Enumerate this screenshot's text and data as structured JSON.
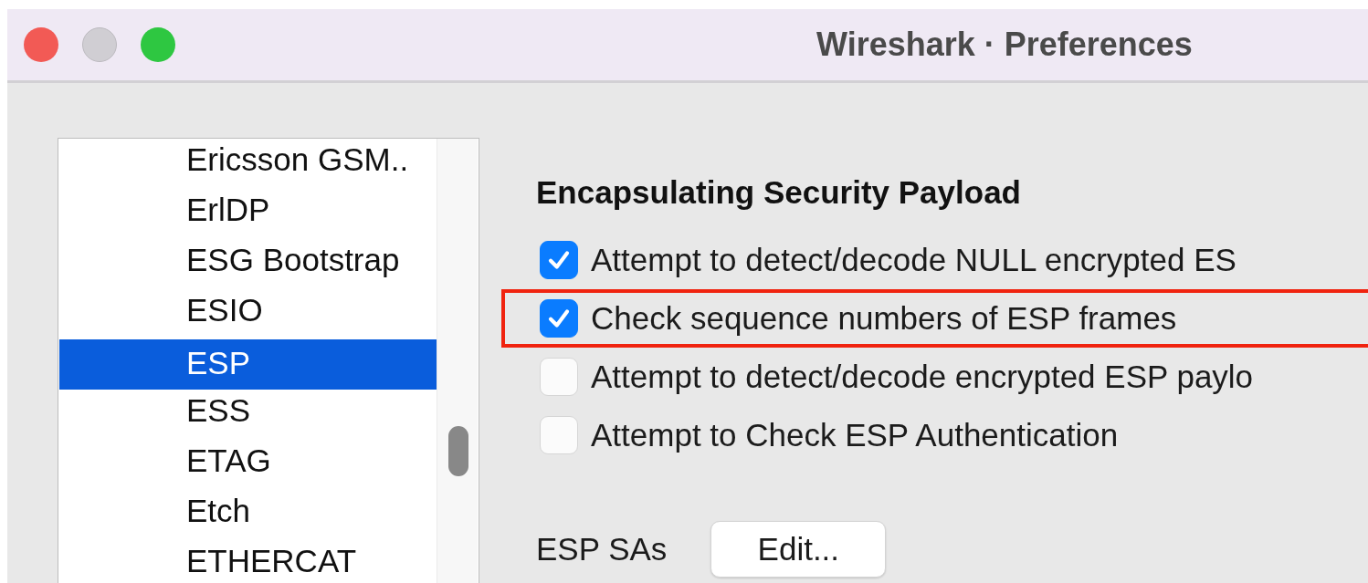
{
  "window": {
    "title": "Wireshark · Preferences"
  },
  "protocol_list": {
    "items": [
      {
        "label": "Ericsson GSM..",
        "selected": false
      },
      {
        "label": "ErlDP",
        "selected": false
      },
      {
        "label": "ESG Bootstrap",
        "selected": false
      },
      {
        "label": "ESIO",
        "selected": false
      },
      {
        "label": "ESP",
        "selected": true
      },
      {
        "label": "ESS",
        "selected": false
      },
      {
        "label": "ETAG",
        "selected": false
      },
      {
        "label": "Etch",
        "selected": false
      },
      {
        "label": "ETHERCAT",
        "selected": false
      }
    ]
  },
  "panel": {
    "heading": "Encapsulating Security Payload",
    "options": [
      {
        "label": "Attempt to detect/decode NULL encrypted ES",
        "checked": true,
        "highlighted": false
      },
      {
        "label": "Check sequence numbers of ESP frames",
        "checked": true,
        "highlighted": true
      },
      {
        "label": "Attempt to detect/decode encrypted ESP paylo",
        "checked": false,
        "highlighted": false
      },
      {
        "label": "Attempt to Check ESP Authentication",
        "checked": false,
        "highlighted": false
      }
    ],
    "sa_label": "ESP SAs",
    "sa_button": "Edit..."
  }
}
